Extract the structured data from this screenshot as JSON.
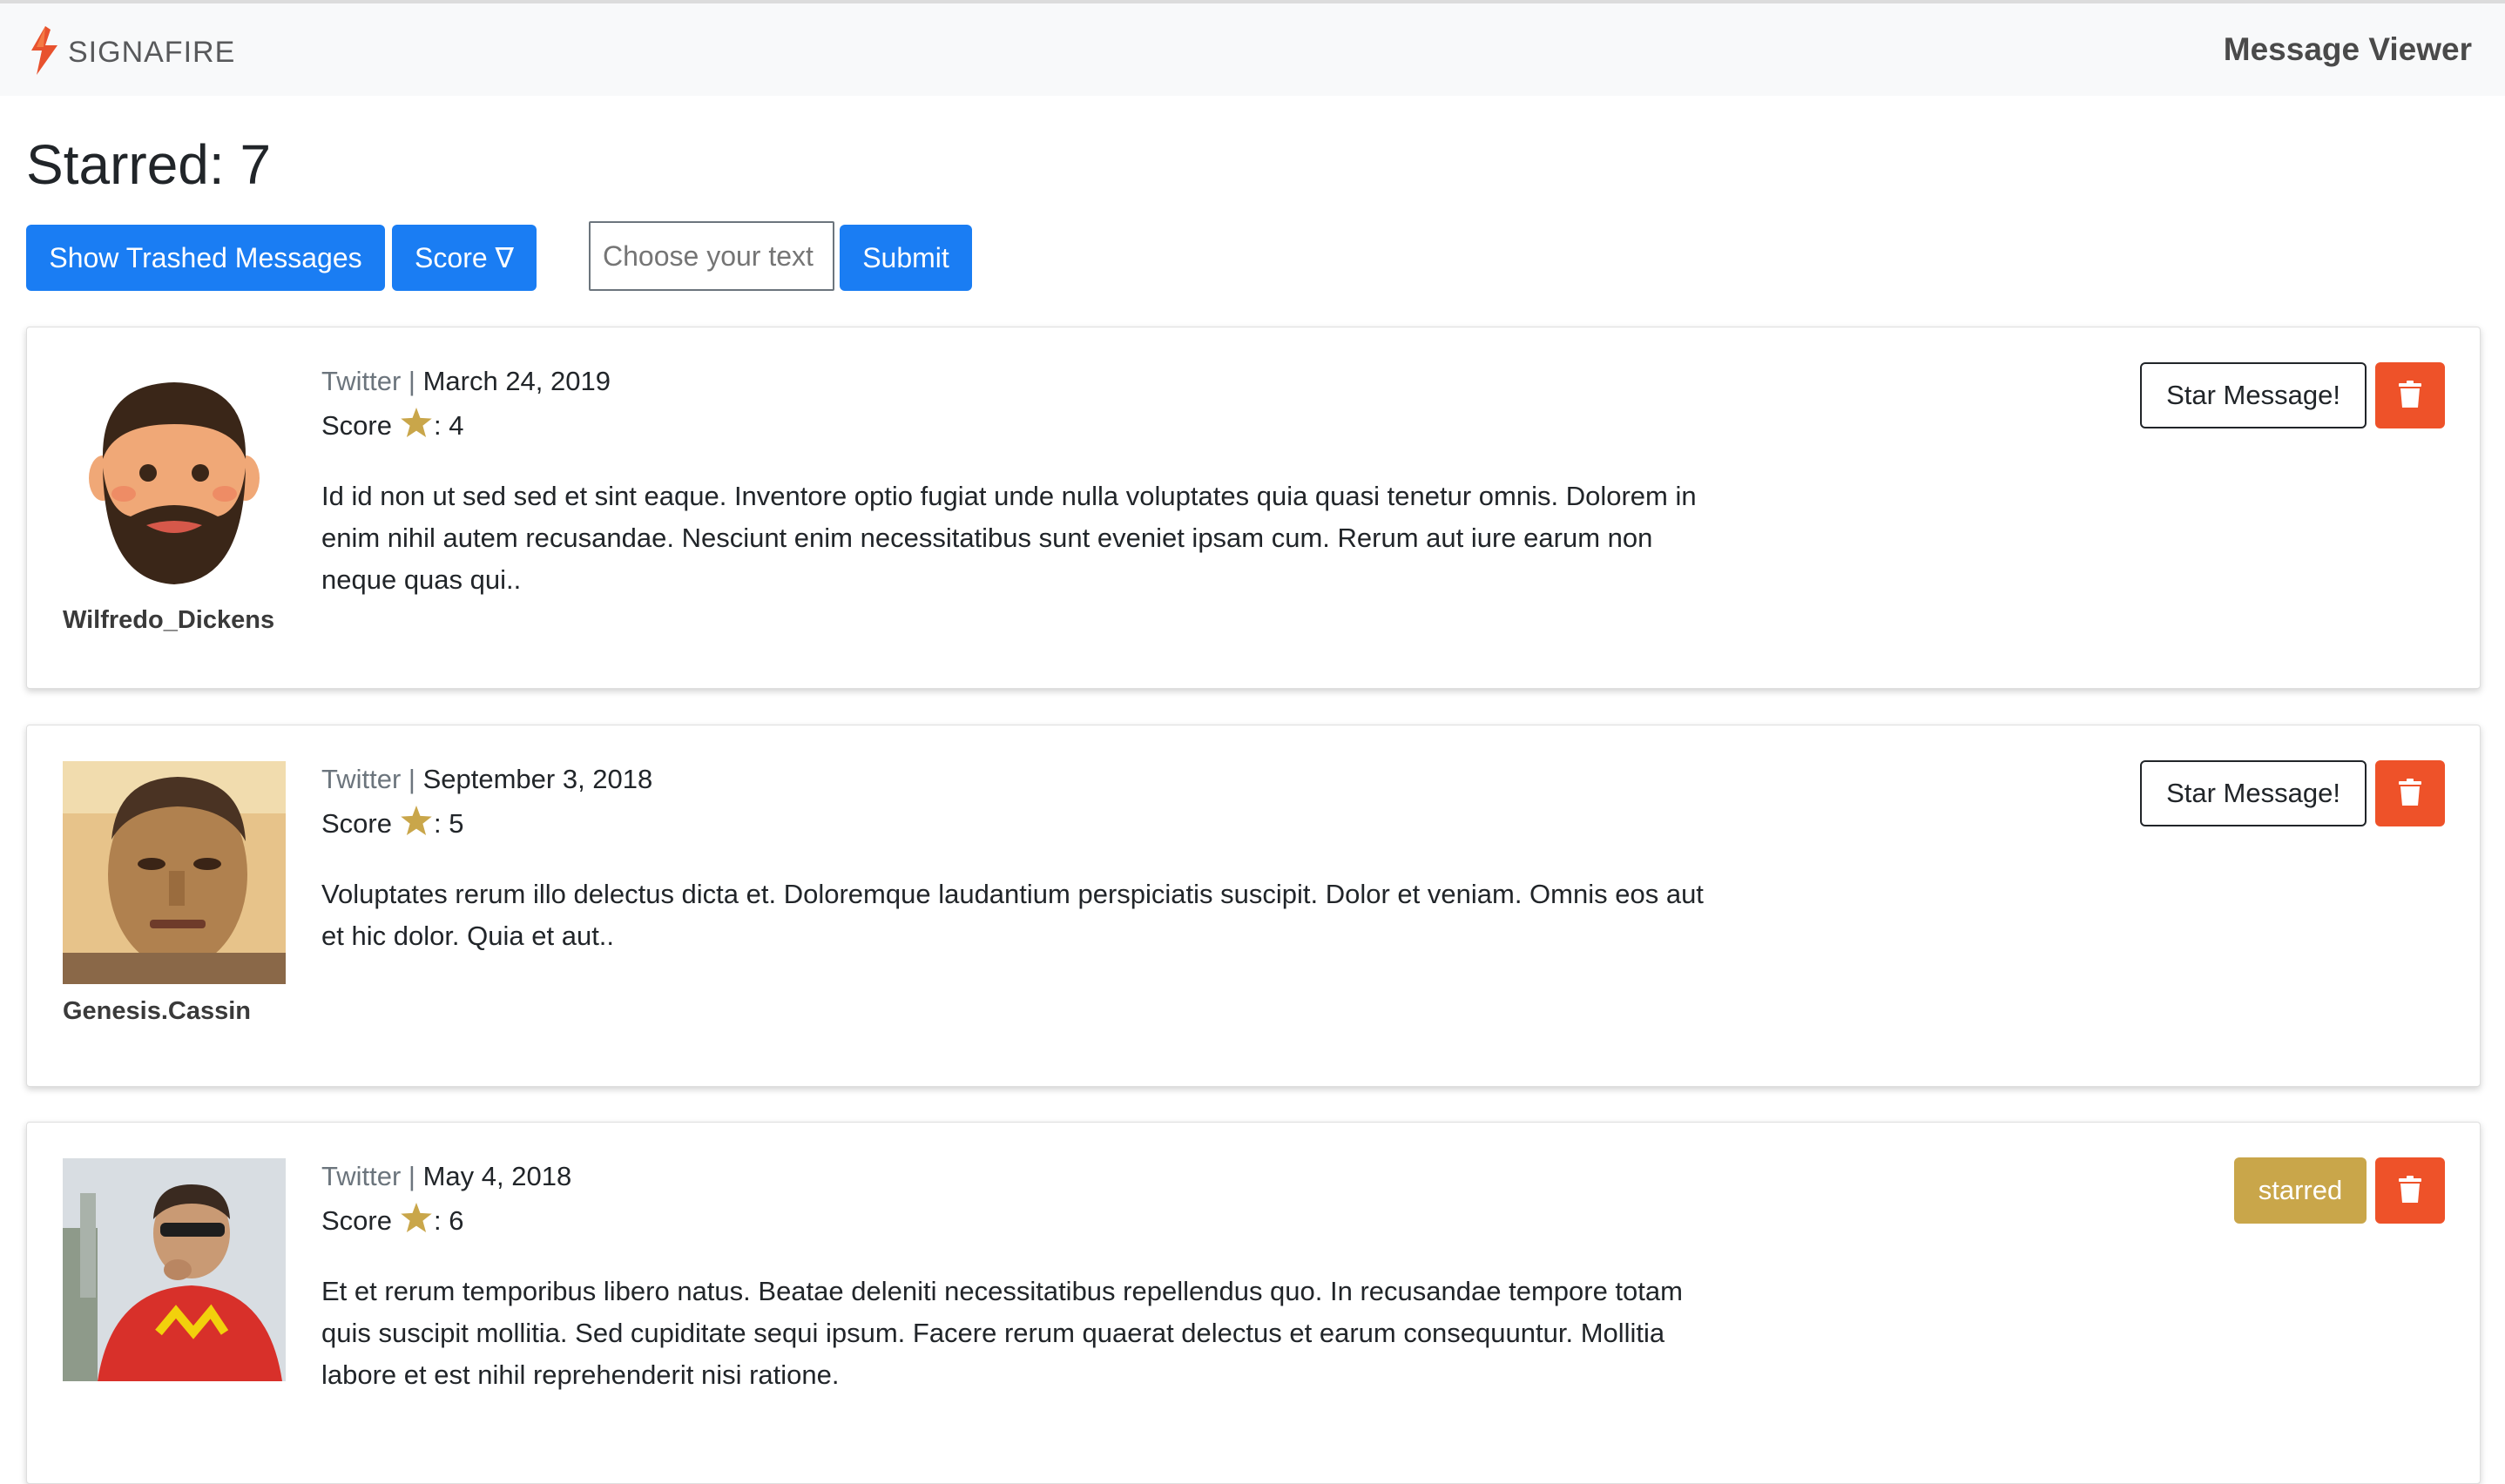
{
  "navbar": {
    "brand": "SIGNAFIRE",
    "title": "Message Viewer"
  },
  "header": {
    "starred_label": "Starred: 7"
  },
  "controls": {
    "trash_button": "Show Trashed Messages",
    "score_button": "Score ∇",
    "text_placeholder": "Choose your text",
    "submit_button": "Submit"
  },
  "messages": [
    {
      "username": "Wilfredo_Dickens",
      "source": "Twitter",
      "separator": " | ",
      "date": "March 24, 2019",
      "score_label": "Score",
      "score_value": ": 4",
      "body": "Id id non ut sed sed et sint eaque. Inventore optio fugiat unde nulla voluptates quia quasi tenetur omnis. Dolorem in enim nihil autem recusandae. Nesciunt enim necessitatibus sunt eveniet ipsam cum. Rerum aut iure earum non neque quas qui..",
      "action": "Star Message!",
      "starred": false
    },
    {
      "username": "Genesis.Cassin",
      "source": "Twitter",
      "separator": " | ",
      "date": "September 3, 2018",
      "score_label": "Score",
      "score_value": ": 5",
      "body": "Voluptates rerum illo delectus dicta et. Doloremque laudantium perspiciatis suscipit. Dolor et veniam. Omnis eos aut et hic dolor. Quia et aut..",
      "action": "Star Message!",
      "starred": false
    },
    {
      "username": "",
      "source": "Twitter",
      "separator": " | ",
      "date": "May 4, 2018",
      "score_label": "Score",
      "score_value": ": 6",
      "body": "Et et rerum temporibus libero natus. Beatae deleniti necessitatibus repellendus quo. In recusandae tempore totam quis suscipit mollitia. Sed cupiditate sequi ipsum. Facere rerum quaerat delectus et earum consequuntur. Mollitia labore et est nihil reprehenderit nisi ratione.",
      "action": "starred",
      "starred": true
    }
  ],
  "colors": {
    "primary": "#1a7df3",
    "danger": "#ee5229",
    "starred": "#c9a64a",
    "star_icon": "#c9a64a",
    "navbar_bg": "#f8f9fa"
  },
  "icons": {
    "brand": "flame-logo-icon",
    "score": "star-icon",
    "delete": "trash-icon"
  }
}
